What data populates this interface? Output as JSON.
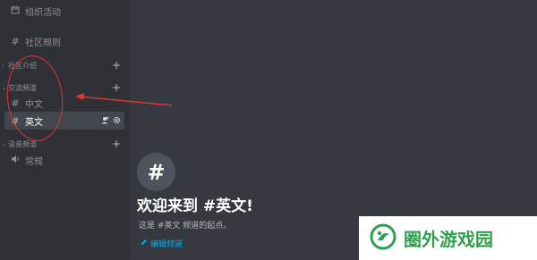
{
  "sidebar": {
    "events": {
      "label": "组织活动",
      "icon": "calendar-icon"
    },
    "rules": {
      "label": "社区规则",
      "icon": "hash-icon"
    },
    "categories": [
      {
        "label": "社区介绍",
        "add": "+"
      },
      {
        "label": "交流频道",
        "add": "+"
      },
      {
        "label": "语音频道",
        "add": "+"
      }
    ],
    "channels": [
      {
        "label": "中文",
        "icon": "#"
      },
      {
        "label": "英文",
        "icon": "#",
        "active": true
      }
    ],
    "voice": [
      {
        "label": "常规",
        "icon": "speaker-icon"
      }
    ]
  },
  "main": {
    "hash_symbol": "#",
    "welcome_title": "欢迎来到 #英文!",
    "welcome_sub": "这是 #英文 频道的起点。",
    "edit_link": "编辑频道"
  },
  "watermark": {
    "text": "圈外游戏园"
  },
  "colors": {
    "background": "#36393f",
    "sidebar": "#2f3136",
    "annotation": "#e03535",
    "link": "#00b0f4",
    "watermark": "#2f9e4d"
  }
}
